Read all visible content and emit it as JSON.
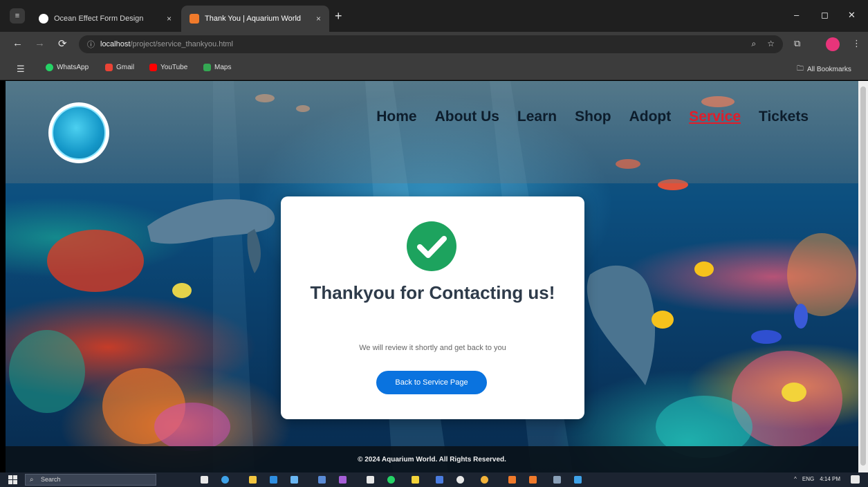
{
  "browser": {
    "menu_glyph": "≡",
    "tabs": [
      {
        "title": "Ocean Effect Form Design",
        "active": false,
        "favicon_color": "#ffffff"
      },
      {
        "title": "Thank You | Aquarium World",
        "active": true,
        "favicon_color": "#f07a2b"
      }
    ],
    "tab_close_glyph": "×",
    "new_tab_glyph": "+",
    "window_controls": {
      "minimize": "–",
      "maximize": "◻",
      "close": "✕"
    },
    "nav": {
      "back": "←",
      "forward": "→",
      "reload": "⟳"
    },
    "address": {
      "host": "localhost",
      "path": "/project/service_thankyou.html"
    },
    "omnibox_icons": [
      "zoom-icon",
      "bookmark-star-icon"
    ],
    "bookmarks": [
      {
        "label": "WhatsApp",
        "color": "#25d366"
      },
      {
        "label": "Gmail",
        "color": "#ea4335"
      },
      {
        "label": "YouTube",
        "color": "#ff0000"
      },
      {
        "label": "Maps",
        "color": "#34a853"
      }
    ],
    "all_bookmarks_label": "All Bookmarks"
  },
  "site": {
    "nav": [
      {
        "label": "Home",
        "current": false
      },
      {
        "label": "About Us",
        "current": false
      },
      {
        "label": "Learn",
        "current": false
      },
      {
        "label": "Shop",
        "current": false
      },
      {
        "label": "Adopt",
        "current": false
      },
      {
        "label": "Service",
        "current": true
      },
      {
        "label": "Tickets",
        "current": false
      }
    ],
    "card": {
      "title": "Thankyou for Contacting us!",
      "message": "We will review it shortly and get back to you",
      "button_label": "Back to Service Page",
      "check_color": "#1da35e",
      "button_color": "#0a73df"
    },
    "footer": "© 2024 Aquarium World. All Rights Reserved."
  },
  "taskbar": {
    "search_placeholder": "Search",
    "tray": {
      "language": "ENG",
      "time": "4:14 PM"
    }
  }
}
